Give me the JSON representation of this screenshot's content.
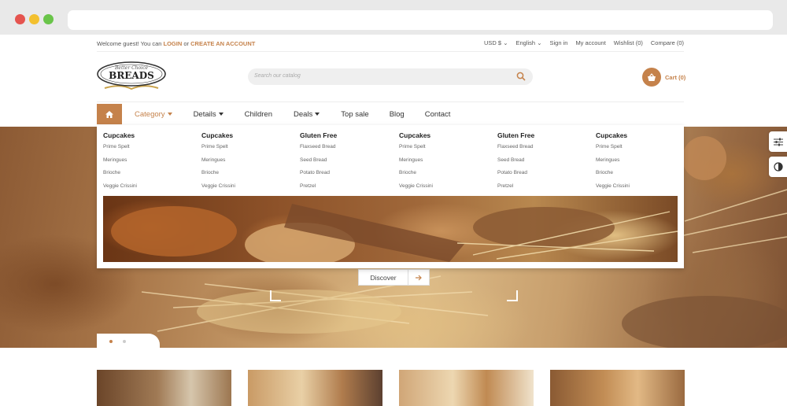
{
  "topbar": {
    "welcome_prefix": "Welcome guest! You can",
    "login": "LOGIN",
    "or": "or",
    "create_account": "CREATE AN ACCOUNT",
    "currency": "USD $",
    "language": "English",
    "sign_in": "Sign in",
    "my_account": "My account",
    "wishlist": "Wishlist (0)",
    "compare": "Compare (0)"
  },
  "logo": {
    "line1": "Better Choice",
    "line2": "BREADS"
  },
  "search": {
    "placeholder": "Search our catalog"
  },
  "cart": {
    "label": "Cart (0)"
  },
  "nav": {
    "items": [
      {
        "label": "Category",
        "dropdown": true
      },
      {
        "label": "Details",
        "dropdown": true
      },
      {
        "label": "Children"
      },
      {
        "label": "Deals",
        "dropdown": true
      },
      {
        "label": "Top sale"
      },
      {
        "label": "Blog"
      },
      {
        "label": "Contact"
      }
    ]
  },
  "mega_menu": {
    "columns": [
      {
        "title": "Cupcakes",
        "links": [
          "Prime Spelt",
          "Meringues",
          "Brioche",
          "Veggie Crissini"
        ]
      },
      {
        "title": "Cupcakes",
        "links": [
          "Prime Spelt",
          "Meringues",
          "Brioche",
          "Veggie Crissini"
        ]
      },
      {
        "title": "Gluten Free",
        "links": [
          "Flaxseed Bread",
          "Seed Bread",
          "Potato Bread",
          "Pretzel"
        ]
      },
      {
        "title": "Cupcakes",
        "links": [
          "Prime Spelt",
          "Meringues",
          "Brioche",
          "Veggie Crissini"
        ]
      },
      {
        "title": "Gluten Free",
        "links": [
          "Flaxseed Bread",
          "Seed Bread",
          "Potato Bread",
          "Pretzel"
        ]
      },
      {
        "title": "Cupcakes",
        "links": [
          "Prime Spelt",
          "Meringues",
          "Brioche",
          "Veggie Crissini"
        ]
      }
    ]
  },
  "hero": {
    "button": "Discover"
  },
  "colors": {
    "accent": "#c5824b"
  }
}
